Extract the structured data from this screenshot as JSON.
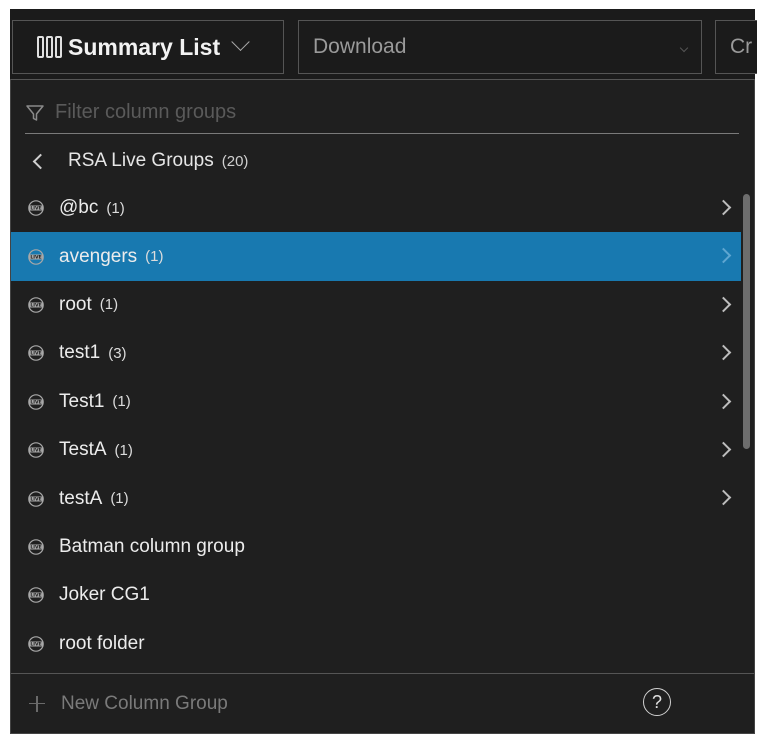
{
  "toolbar": {
    "view_label": "Summary List",
    "download_label": "Download",
    "partial_button_label": "Cr"
  },
  "panel": {
    "filter_placeholder": "Filter column groups",
    "group_title": "RSA Live Groups",
    "group_count": "(20)",
    "selected_index": 1,
    "items": [
      {
        "label": "@bc",
        "count": "(1)",
        "has_children": true,
        "icon": "live-icon"
      },
      {
        "label": "avengers",
        "count": "(1)",
        "has_children": true,
        "icon": "live-icon"
      },
      {
        "label": "root",
        "count": "(1)",
        "has_children": true,
        "icon": "live-icon"
      },
      {
        "label": "test1",
        "count": "(3)",
        "has_children": true,
        "icon": "live-icon"
      },
      {
        "label": "Test1",
        "count": "(1)",
        "has_children": true,
        "icon": "live-icon"
      },
      {
        "label": "TestA",
        "count": "(1)",
        "has_children": true,
        "icon": "live-icon"
      },
      {
        "label": "testA",
        "count": "(1)",
        "has_children": true,
        "icon": "live-icon"
      },
      {
        "label": "Batman column group",
        "count": "",
        "has_children": false,
        "icon": "live-icon"
      },
      {
        "label": "Joker CG1",
        "count": "",
        "has_children": false,
        "icon": "live-icon"
      },
      {
        "label": "root folder",
        "count": "",
        "has_children": false,
        "icon": "live-icon"
      }
    ],
    "new_group_label": "New Column Group",
    "help_symbol": "?"
  },
  "colors": {
    "background": "#1b1b1b",
    "panel": "#1f1f1f",
    "selected": "#1879b0",
    "text": "#e6e6e6",
    "muted": "#7a7a7a"
  }
}
